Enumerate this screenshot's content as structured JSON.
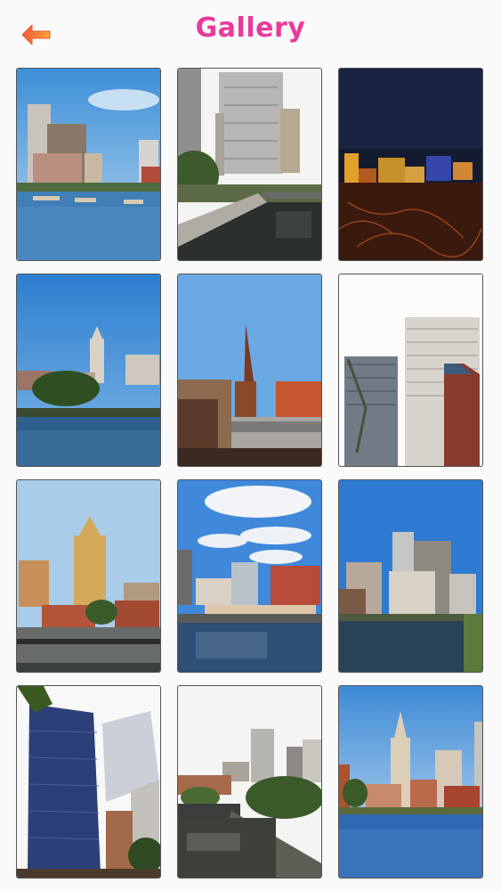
{
  "header": {
    "title": "Gallery",
    "back_icon": "arrow-left-icon",
    "accent_color": "#e93b9b",
    "back_color": "#f26a3a"
  },
  "gallery": {
    "photos": [
      {
        "id": 1,
        "subject": "river-skyline"
      },
      {
        "id": 2,
        "subject": "riverwalk-buildings"
      },
      {
        "id": 3,
        "subject": "city-night"
      },
      {
        "id": 4,
        "subject": "waterfront-tower"
      },
      {
        "id": 5,
        "subject": "church-spire"
      },
      {
        "id": 6,
        "subject": "office-towers"
      },
      {
        "id": 7,
        "subject": "art-deco-tower"
      },
      {
        "id": 8,
        "subject": "canal-clouds"
      },
      {
        "id": 9,
        "subject": "river-offices"
      },
      {
        "id": 10,
        "subject": "glass-highrises"
      },
      {
        "id": 11,
        "subject": "river-bridge"
      },
      {
        "id": 12,
        "subject": "harbor-skyline"
      }
    ]
  }
}
